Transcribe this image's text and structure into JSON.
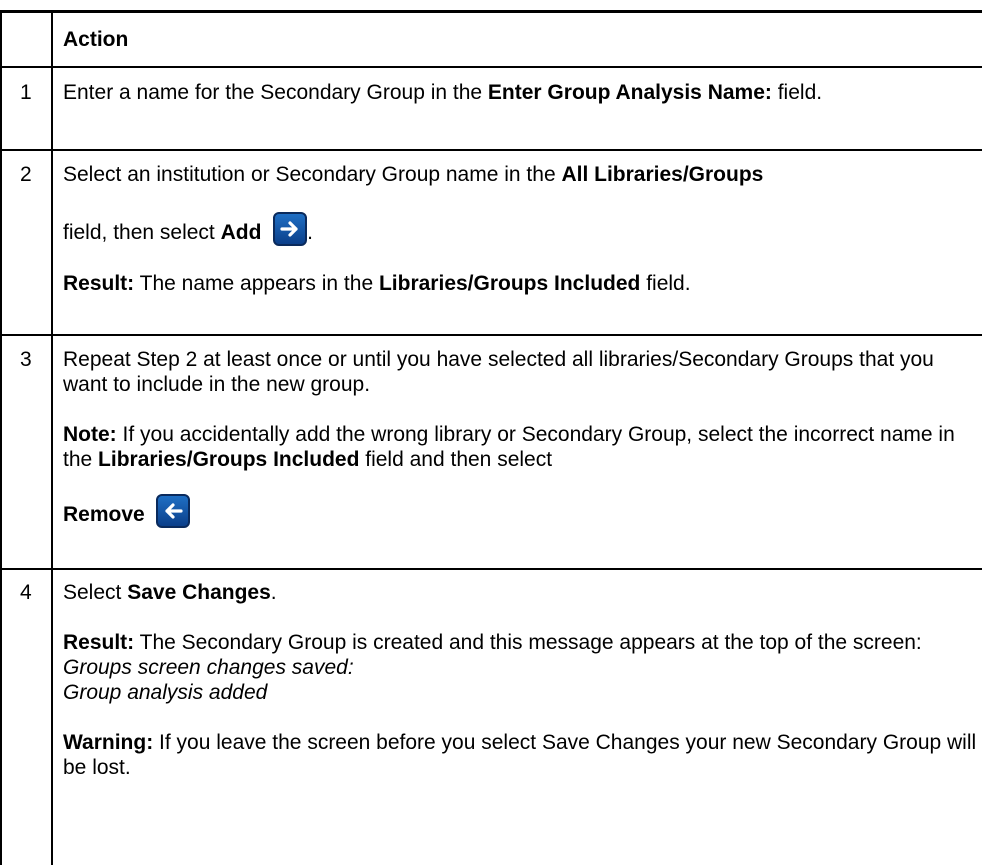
{
  "header": {
    "num": "",
    "action": "Action"
  },
  "rows": [
    {
      "num": "1",
      "p1a": "Enter a name for the Secondary Group in the ",
      "p1b": "Enter Group Analysis Name:",
      "p1c": " field."
    },
    {
      "num": "2",
      "p1a": "Select an institution or Secondary Group name in the ",
      "p1b": "All Libraries/Groups",
      "p2a": "field, then select ",
      "p2b": "Add",
      "p2c": ".",
      "add_icon": "arrow-right-icon",
      "p3a": "Result:",
      "p3b": " The name appears in the ",
      "p3c": "Libraries/Groups Included",
      "p3d": " field."
    },
    {
      "num": "3",
      "p1": "Repeat Step 2 at least once or until you have selected all libraries/Secondary Groups that you want to include in the new group.",
      "p2a": "Note:",
      "p2b": " If you accidentally add the wrong library or Secondary Group, select the incorrect name in the ",
      "p2c": "Libraries/Groups Included",
      "p2d": " field and then select",
      "p3": "Remove",
      "remove_icon": "arrow-left-icon"
    },
    {
      "num": "4",
      "p1a": "Select ",
      "p1b": "Save Changes",
      "p1c": ".",
      "p2a": "Result:",
      "p2b": " The Secondary Group is created and this message appears at the top of the screen:",
      "p2c": "Groups screen changes saved:",
      "p2d": "Group analysis added",
      "p3a": "Warning:",
      "p3b": " If you leave the screen before you select Save Changes your new Secondary Group will be lost."
    }
  ],
  "colors": {
    "button_top": "#1f6fc4",
    "button_bottom": "#0b3f8a",
    "rule": "#000000"
  }
}
